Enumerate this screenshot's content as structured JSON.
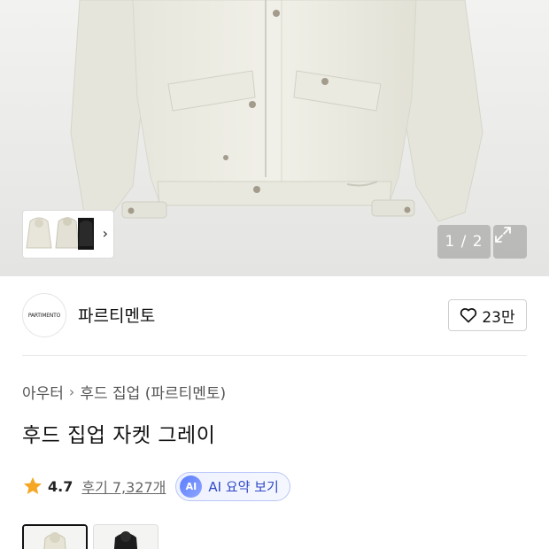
{
  "gallery": {
    "counter": "1 / 2",
    "thumbnails": [
      {
        "name": "jacket-front-ivory"
      },
      {
        "name": "jacket-back-ivory"
      },
      {
        "name": "jacket-black"
      }
    ],
    "next_icon": "chevron-right-icon",
    "expand_icon": "expand-icon"
  },
  "brand": {
    "logo_text": "PARTIMENTO",
    "name": "파르티멘토",
    "like_count": "23만"
  },
  "breadcrumb": {
    "category": "아우터",
    "separator": "›",
    "subcategory": "후드 집업 (파르티멘토)"
  },
  "product": {
    "title": "후드 집업 자켓 그레이"
  },
  "rating": {
    "score": "4.7",
    "reviews": "후기 7,327개",
    "star_color": "#f5a623"
  },
  "ai_summary": {
    "badge": "AI",
    "label": "AI 요약 보기",
    "accent": "#3049c6"
  },
  "colors": [
    {
      "name": "ivory",
      "selected": true
    },
    {
      "name": "black",
      "selected": false
    }
  ]
}
